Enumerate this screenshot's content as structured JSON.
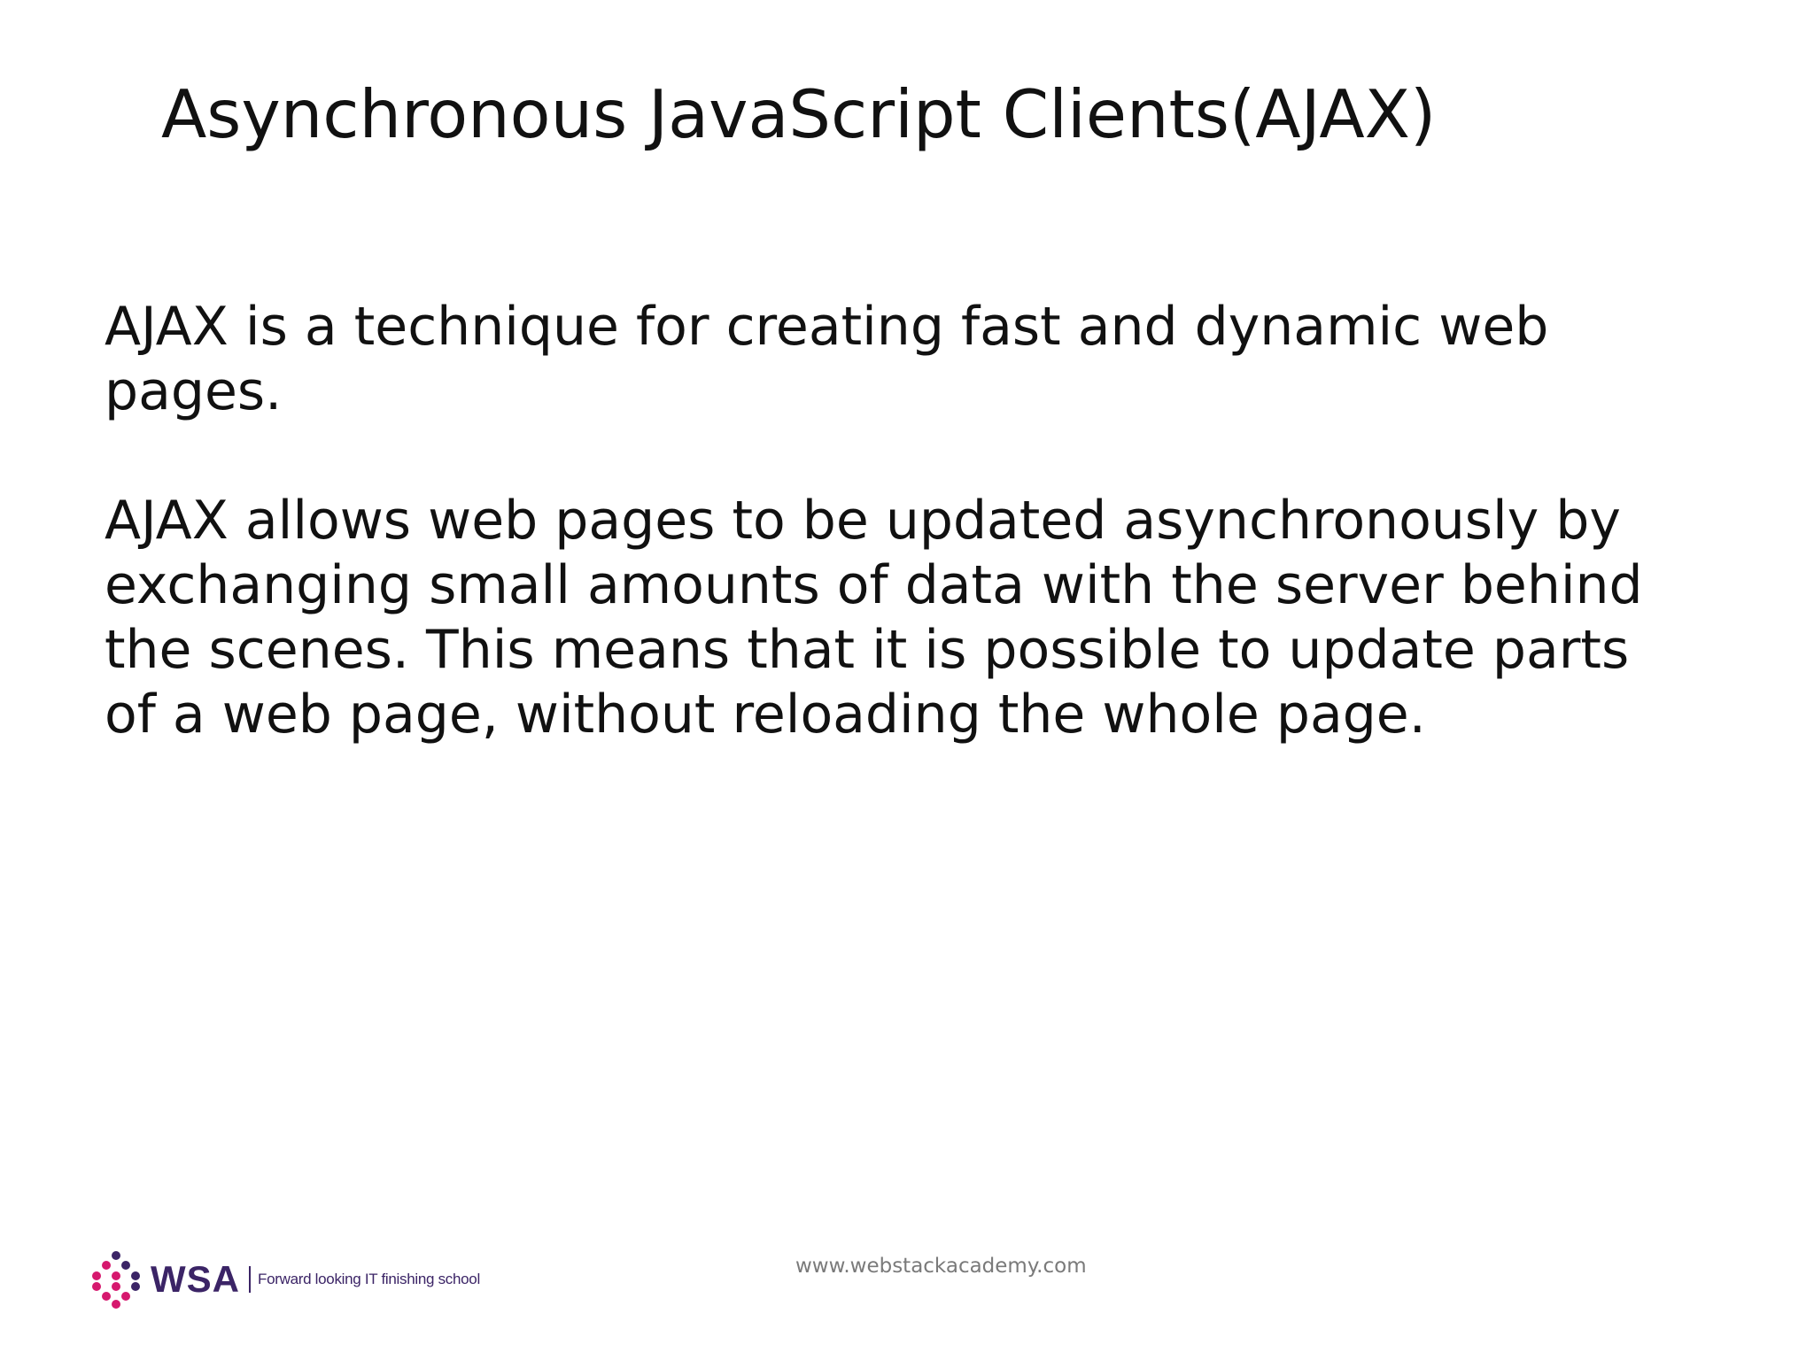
{
  "slide": {
    "title": "Asynchronous JavaScript Clients(AJAX)",
    "paragraphs": [
      "AJAX is a technique for creating fast and dynamic web\npages.",
      "AJAX allows web pages to be updated asynchronously by\nexchanging small amounts of data with the server behind\nthe scenes. This means that it is possible to update parts\nof a web page, without reloading the whole page."
    ]
  },
  "footer": {
    "url": "www.webstackacademy.com",
    "logo": {
      "icon": "wsa-dots-logo-icon",
      "wordmark": "WSA",
      "tagline": "Forward looking IT finishing school",
      "colors": {
        "magenta": "#d6186e",
        "purple": "#3b2466"
      }
    }
  }
}
